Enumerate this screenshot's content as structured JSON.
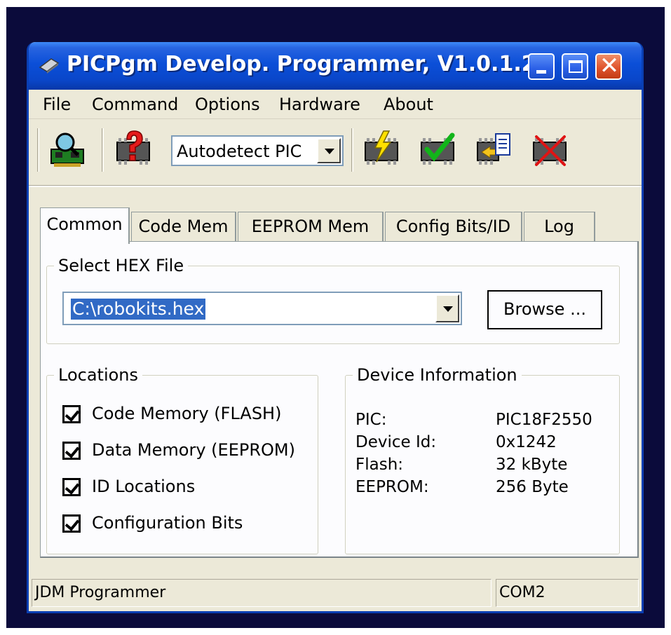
{
  "window": {
    "title": "PICPgm Develop. Programmer, V1.0.1.2",
    "close_glyph": "✕"
  },
  "menu": [
    "File",
    "Command",
    "Options",
    "Hardware",
    "About"
  ],
  "toolbar": {
    "device_select": "Autodetect PIC",
    "icons": [
      "programmer-hardware-icon",
      "autodetect-device-icon",
      "program-device-icon",
      "verify-device-icon",
      "read-device-icon",
      "erase-device-icon"
    ]
  },
  "tabs": [
    "Common",
    "Code Mem",
    "EEPROM Mem",
    "Config Bits/ID",
    "Log"
  ],
  "hex_file": {
    "group_title": "Select HEX File",
    "path": "C:\\robokits.hex",
    "browse_label": "Browse ..."
  },
  "locations": {
    "group_title": "Locations",
    "items": [
      {
        "label": "Code Memory (FLASH)",
        "checked": true
      },
      {
        "label": "Data Memory (EEPROM)",
        "checked": true
      },
      {
        "label": "ID Locations",
        "checked": true
      },
      {
        "label": "Configuration Bits",
        "checked": true
      }
    ]
  },
  "device_info": {
    "group_title": "Device Information",
    "rows": [
      {
        "key": "PIC:",
        "value": "PIC18F2550"
      },
      {
        "key": "Device Id:",
        "value": "0x1242"
      },
      {
        "key": "Flash:",
        "value": "32 kByte"
      },
      {
        "key": "EEPROM:",
        "value": "256 Byte"
      }
    ]
  },
  "status": {
    "programmer": "JDM Programmer",
    "port": "COM2"
  },
  "colors": {
    "titlebar": "#0b4fd8",
    "selection": "#316ac5",
    "backdrop": "#0b0b3b"
  }
}
